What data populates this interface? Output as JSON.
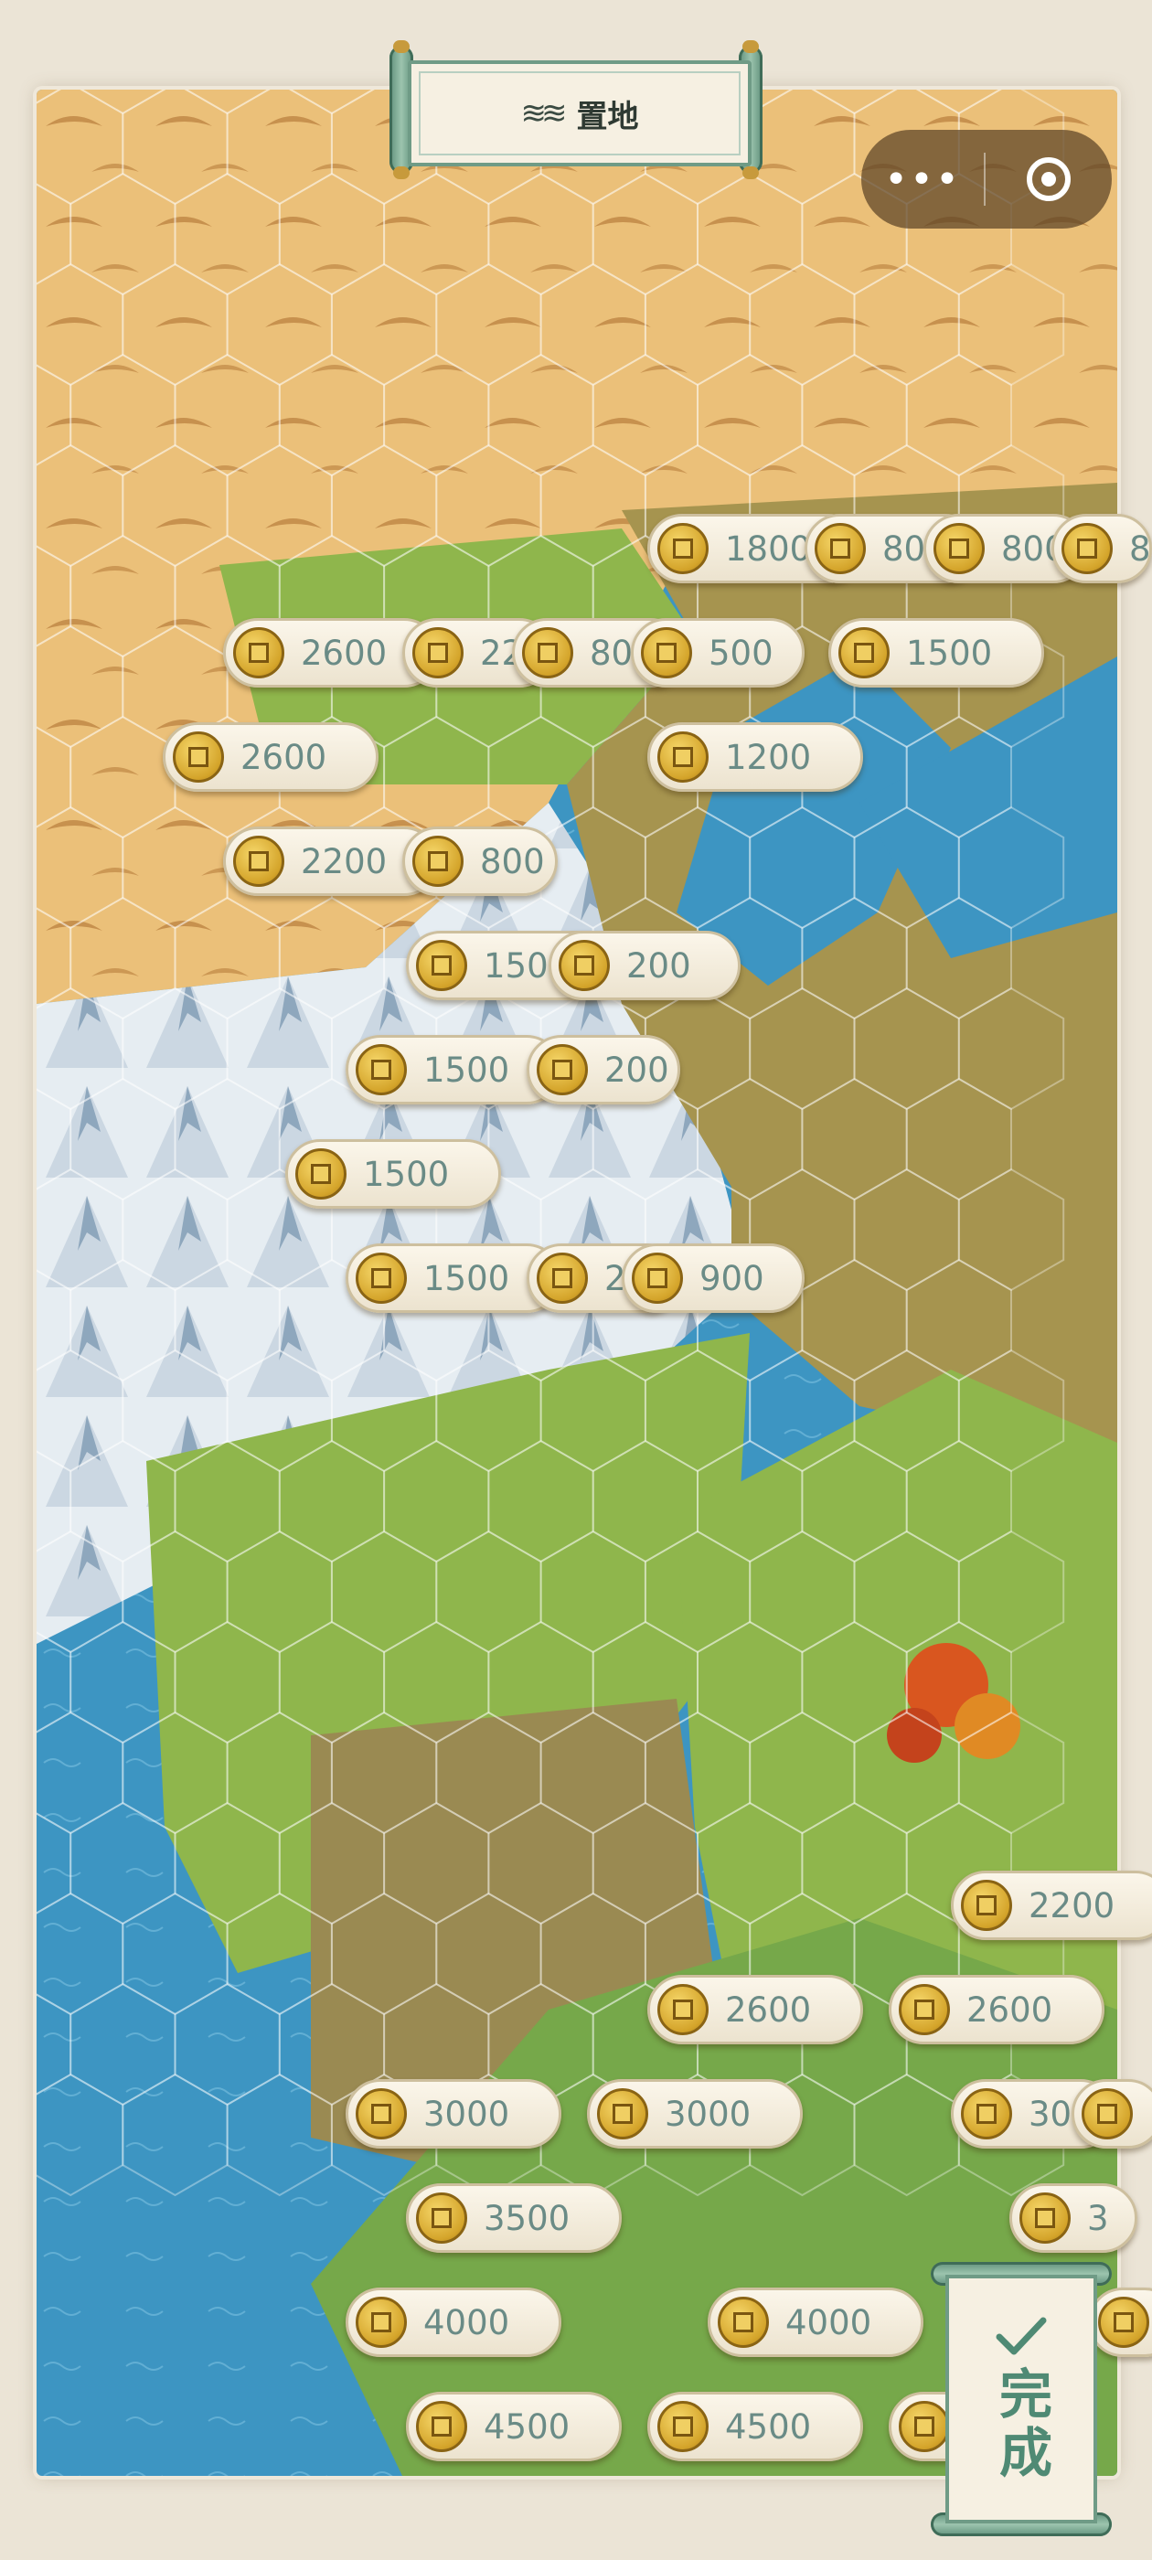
{
  "title": {
    "icon": "grass-land-icon",
    "text": "置地"
  },
  "capsule": {
    "more_label": "•••",
    "icons": [
      "more-dots-icon",
      "target-icon"
    ]
  },
  "colors": {
    "desert": "#ebc079",
    "grass": "#8fb64c",
    "water": "#3d95c2",
    "snow": "#e6edf2",
    "tag_text": "#6a8b86",
    "accent_green": "#6f9b86"
  },
  "price_tags": [
    {
      "price": "1800"
    },
    {
      "price": "800"
    },
    {
      "price": "800"
    },
    {
      "price": "8"
    },
    {
      "price": "2600"
    },
    {
      "price": "2200"
    },
    {
      "price": "800"
    },
    {
      "price": "500"
    },
    {
      "price": "1500"
    },
    {
      "price": "2600"
    },
    {
      "price": "1200"
    },
    {
      "price": "2200"
    },
    {
      "price": "800"
    },
    {
      "price": "1500"
    },
    {
      "price": "200"
    },
    {
      "price": "1500"
    },
    {
      "price": "200"
    },
    {
      "price": "1500"
    },
    {
      "price": "1500"
    },
    {
      "price": "200"
    },
    {
      "price": "900"
    },
    {
      "price": "2200"
    },
    {
      "price": "2600"
    },
    {
      "price": "2600"
    },
    {
      "price": "3000"
    },
    {
      "price": "3000"
    },
    {
      "price": "30"
    },
    {
      "price": ""
    },
    {
      "price": "3500"
    },
    {
      "price": "3"
    },
    {
      "price": "4000"
    },
    {
      "price": "4000"
    },
    {
      "price": ""
    },
    {
      "price": "4500"
    },
    {
      "price": "4500"
    },
    {
      "price": ""
    }
  ],
  "done": {
    "label": "完成",
    "icon": "checkmark-icon"
  }
}
